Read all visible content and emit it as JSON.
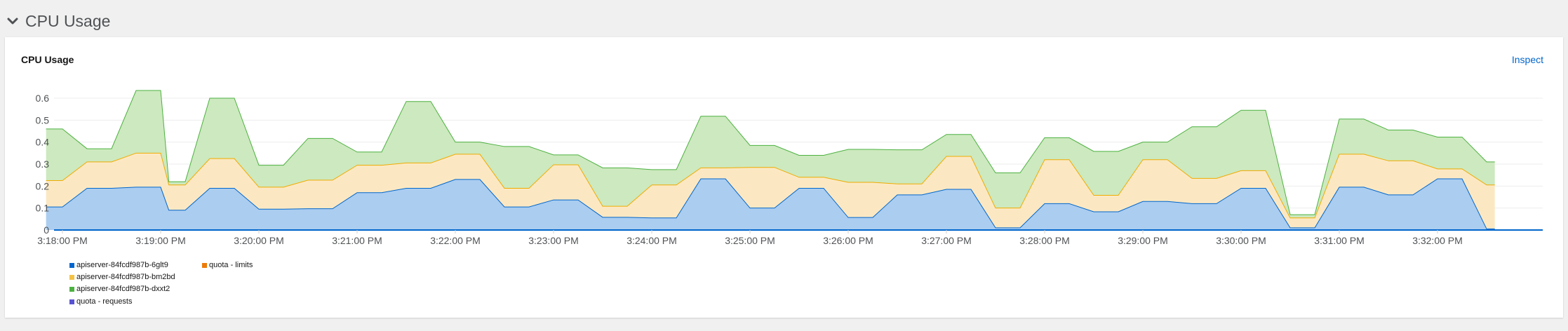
{
  "section": {
    "title": "CPU Usage",
    "toggle_icon": "chevron-down-icon"
  },
  "card": {
    "title": "CPU Usage",
    "inspect_label": "Inspect"
  },
  "colors": {
    "pod1_fill": "#abcdf0",
    "pod1_line": "#06c",
    "pod2_fill": "#fbe8c3",
    "pod2_line": "#f0ab00",
    "pod3_fill": "#cde9bf",
    "pod3_line": "#4cb140",
    "limits": "#ec7a08",
    "requests": "#5752d1",
    "grid": "#ededed"
  },
  "legend": [
    {
      "label": "apiserver-84fcdf987b-6glt9",
      "color": "#06c"
    },
    {
      "label": "apiserver-84fcdf987b-bm2bd",
      "color": "#f4c145"
    },
    {
      "label": "apiserver-84fcdf987b-dxxt2",
      "color": "#4cb140"
    },
    {
      "label": "quota - requests",
      "color": "#5752d1"
    },
    {
      "label": "quota - limits",
      "color": "#ec7a08"
    }
  ],
  "chart_data": {
    "type": "area",
    "stacked": true,
    "title": "CPU Usage",
    "xlabel": "",
    "ylabel": "",
    "ylim": [
      0,
      0.65
    ],
    "y_ticks": [
      "0",
      "0.1",
      "0.2",
      "0.3",
      "0.4",
      "0.5",
      "0.6"
    ],
    "x_ticks": [
      "3:18:00 PM",
      "3:19:00 PM",
      "3:20:00 PM",
      "3:21:00 PM",
      "3:22:00 PM",
      "3:23:00 PM",
      "3:24:00 PM",
      "3:25:00 PM",
      "3:26:00 PM",
      "3:27:00 PM",
      "3:28:00 PM",
      "3:29:00 PM",
      "3:30:00 PM",
      "3:31:00 PM",
      "3:32:00 PM"
    ],
    "grid": true,
    "legend_position": "bottom-left",
    "x": [
      "3:17:50 PM",
      "3:18:00 PM",
      "3:18:15 PM",
      "3:18:30 PM",
      "3:18:45 PM",
      "3:19:00 PM",
      "3:19:05 PM",
      "3:19:15 PM",
      "3:19:30 PM",
      "3:19:45 PM",
      "3:20:00 PM",
      "3:20:15 PM",
      "3:20:30 PM",
      "3:20:45 PM",
      "3:21:00 PM",
      "3:21:15 PM",
      "3:21:30 PM",
      "3:21:45 PM",
      "3:22:00 PM",
      "3:22:15 PM",
      "3:22:30 PM",
      "3:22:45 PM",
      "3:23:00 PM",
      "3:23:15 PM",
      "3:23:30 PM",
      "3:23:45 PM",
      "3:24:00 PM",
      "3:24:15 PM",
      "3:24:30 PM",
      "3:24:45 PM",
      "3:25:00 PM",
      "3:25:15 PM",
      "3:25:30 PM",
      "3:25:45 PM",
      "3:26:00 PM",
      "3:26:15 PM",
      "3:26:30 PM",
      "3:26:45 PM",
      "3:27:00 PM",
      "3:27:15 PM",
      "3:27:30 PM",
      "3:27:45 PM",
      "3:28:00 PM",
      "3:28:15 PM",
      "3:28:30 PM",
      "3:28:45 PM",
      "3:29:00 PM",
      "3:29:15 PM",
      "3:29:30 PM",
      "3:29:45 PM",
      "3:30:00 PM",
      "3:30:15 PM",
      "3:30:30 PM",
      "3:30:45 PM",
      "3:31:00 PM",
      "3:31:15 PM",
      "3:31:30 PM",
      "3:31:45 PM",
      "3:32:00 PM",
      "3:32:15 PM",
      "3:32:30 PM",
      "3:32:35 PM"
    ],
    "series": [
      {
        "name": "apiserver-84fcdf987b-6glt9",
        "values": [
          0.105,
          0.105,
          0.19,
          0.19,
          0.195,
          0.195,
          0.09,
          0.09,
          0.19,
          0.19,
          0.095,
          0.095,
          0.097,
          0.097,
          0.17,
          0.17,
          0.19,
          0.19,
          0.23,
          0.23,
          0.105,
          0.105,
          0.137,
          0.137,
          0.058,
          0.058,
          0.055,
          0.055,
          0.233,
          0.233,
          0.1,
          0.1,
          0.19,
          0.19,
          0.057,
          0.057,
          0.16,
          0.16,
          0.185,
          0.185,
          0.01,
          0.01,
          0.12,
          0.12,
          0.083,
          0.083,
          0.13,
          0.13,
          0.12,
          0.12,
          0.19,
          0.19,
          0.01,
          0.01,
          0.195,
          0.195,
          0.16,
          0.16,
          0.233,
          0.233,
          0.005,
          0.005
        ]
      },
      {
        "name": "apiserver-84fcdf987b-bm2bd",
        "values": [
          0.12,
          0.12,
          0.12,
          0.12,
          0.155,
          0.155,
          0.115,
          0.115,
          0.135,
          0.135,
          0.1,
          0.1,
          0.13,
          0.13,
          0.125,
          0.125,
          0.115,
          0.115,
          0.115,
          0.115,
          0.085,
          0.085,
          0.16,
          0.16,
          0.05,
          0.05,
          0.15,
          0.15,
          0.05,
          0.05,
          0.185,
          0.185,
          0.05,
          0.05,
          0.16,
          0.16,
          0.05,
          0.05,
          0.15,
          0.15,
          0.09,
          0.09,
          0.2,
          0.2,
          0.075,
          0.075,
          0.19,
          0.19,
          0.115,
          0.115,
          0.08,
          0.08,
          0.045,
          0.045,
          0.15,
          0.15,
          0.155,
          0.155,
          0.045,
          0.045,
          0.2,
          0.2
        ]
      },
      {
        "name": "apiserver-84fcdf987b-dxxt2",
        "values": [
          0.235,
          0.235,
          0.06,
          0.06,
          0.285,
          0.285,
          0.015,
          0.015,
          0.275,
          0.275,
          0.1,
          0.1,
          0.19,
          0.19,
          0.06,
          0.06,
          0.28,
          0.28,
          0.055,
          0.055,
          0.19,
          0.19,
          0.045,
          0.045,
          0.175,
          0.175,
          0.07,
          0.07,
          0.235,
          0.235,
          0.1,
          0.1,
          0.1,
          0.1,
          0.15,
          0.15,
          0.155,
          0.155,
          0.1,
          0.1,
          0.16,
          0.16,
          0.1,
          0.1,
          0.2,
          0.2,
          0.08,
          0.08,
          0.235,
          0.235,
          0.275,
          0.275,
          0.015,
          0.015,
          0.16,
          0.16,
          0.14,
          0.14,
          0.145,
          0.145,
          0.105,
          0.105
        ]
      }
    ]
  }
}
